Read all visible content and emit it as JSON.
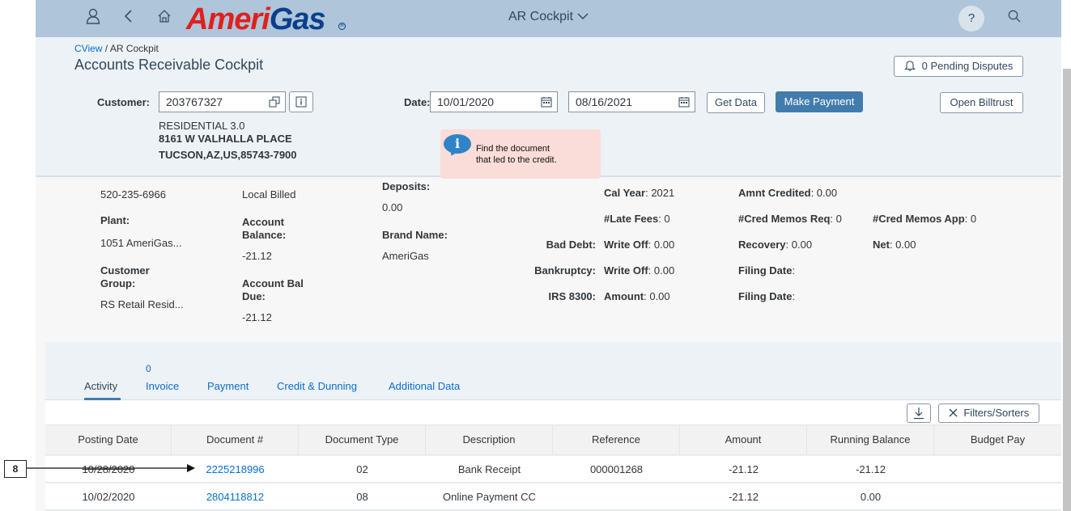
{
  "shell": {
    "app_title": "AR Cockpit",
    "logo_text_red": "Ameri",
    "logo_text_blue": "Gas",
    "logo_reg": "R",
    "help_label": "?"
  },
  "header": {
    "breadcrumb_link": "CView",
    "breadcrumb_sep": " / ",
    "breadcrumb_current": "AR Cockpit",
    "title": "Accounts Receivable Cockpit",
    "pending_disputes": "0 Pending Disputes"
  },
  "filters": {
    "customer_label": "Customer:",
    "customer_value": "203767327",
    "date_label": "Date:",
    "date_from": "10/01/2020",
    "date_to": "08/16/2021",
    "get_data": "Get Data",
    "make_payment": "Make Payment",
    "open_billtrust": "Open Billtrust"
  },
  "address": {
    "line1": "RESIDENTIAL 3.0",
    "line2": "8161 W VALHALLA PLACE",
    "line3": "TUCSON,AZ,US,85743-7900"
  },
  "message": {
    "line1": "Find the document",
    "line2": "that led to the credit."
  },
  "details": {
    "phone": "520-235-6966",
    "plant_label": "Plant:",
    "plant_value": "1051 AmeriGas...",
    "customer_group_label_1": "Customer",
    "customer_group_label_2": "Group:",
    "customer_group_value": "RS Retail Resid...",
    "local_billed": "Local Billed",
    "account_balance_label_1": "Account",
    "account_balance_label_2": "Balance:",
    "account_balance_value": "-21.12",
    "account_bal_due_label_1": "Account Bal",
    "account_bal_due_label_2": "Due:",
    "account_bal_due_value": "-21.12",
    "deposits_label": "Deposits:",
    "deposits_value": "0.00",
    "brand_name_label": "Brand Name:",
    "brand_name_value": "AmeriGas",
    "bad_debt_label": "Bad Debt:",
    "bankruptcy_label": "Bankruptcy:",
    "irs_label": "IRS 8300:",
    "cal_year_label": "Cal Year",
    "cal_year_value": ": 2021",
    "late_fees_label": "#Late Fees",
    "late_fees_value": ": 0",
    "write_off_label": "Write Off",
    "write_off_value": ": 0.00",
    "write_off2_label": "Write Off",
    "write_off2_value": ": 0.00",
    "amount_label": "Amount",
    "amount_value": ": 0.00",
    "amnt_credited_label": "Amnt Credited",
    "amnt_credited_value": ": 0.00",
    "cred_memos_req_label": "#Cred Memos Req",
    "cred_memos_req_value": ": 0",
    "cred_memos_app_label": "#Cred Memos App",
    "cred_memos_app_value": ": 0",
    "recovery_label": "Recovery",
    "recovery_value": ": 0.00",
    "net_label": "Net",
    "net_value": ": 0.00",
    "filing_date_label": "Filing Date",
    "filing_date_value": ":",
    "filing_date2_label": "Filing Date",
    "filing_date2_value": ":"
  },
  "tabs": {
    "invoice_count": "0",
    "items": [
      "Activity",
      "Invoice",
      "Payment",
      "Credit & Dunning",
      "Additional Data"
    ]
  },
  "toolbar": {
    "filters_sorters": "Filters/Sorters"
  },
  "table": {
    "columns": [
      "Posting Date",
      "Document #",
      "Document Type",
      "Description",
      "Reference",
      "Amount",
      "Running Balance",
      "Budget Pay"
    ],
    "rows": [
      [
        "10/28/2020",
        "2225218996",
        "02",
        "Bank Receipt",
        "000001268",
        "-21.12",
        "-21.12",
        ""
      ],
      [
        "10/02/2020",
        "2804118812",
        "08",
        "Online Payment CC",
        "",
        "-21.12",
        "0.00",
        ""
      ]
    ]
  },
  "annotation": {
    "callout_number": "8"
  },
  "colors": {
    "shell_bg": "#aec5da",
    "header_bg": "#edf2f6",
    "link": "#0a6ed1",
    "emphasized_button": "#427cac",
    "message_bg": "#fadcd8",
    "logo_red": "#e0201c",
    "logo_blue": "#0b3f8a"
  },
  "icons": [
    "user-icon",
    "back-icon",
    "home-icon",
    "chevron-down-icon",
    "search-icon",
    "bell-icon",
    "copy-icon",
    "info-icon",
    "calendar-icon",
    "download-icon",
    "close-icon",
    "message-info-icon"
  ]
}
